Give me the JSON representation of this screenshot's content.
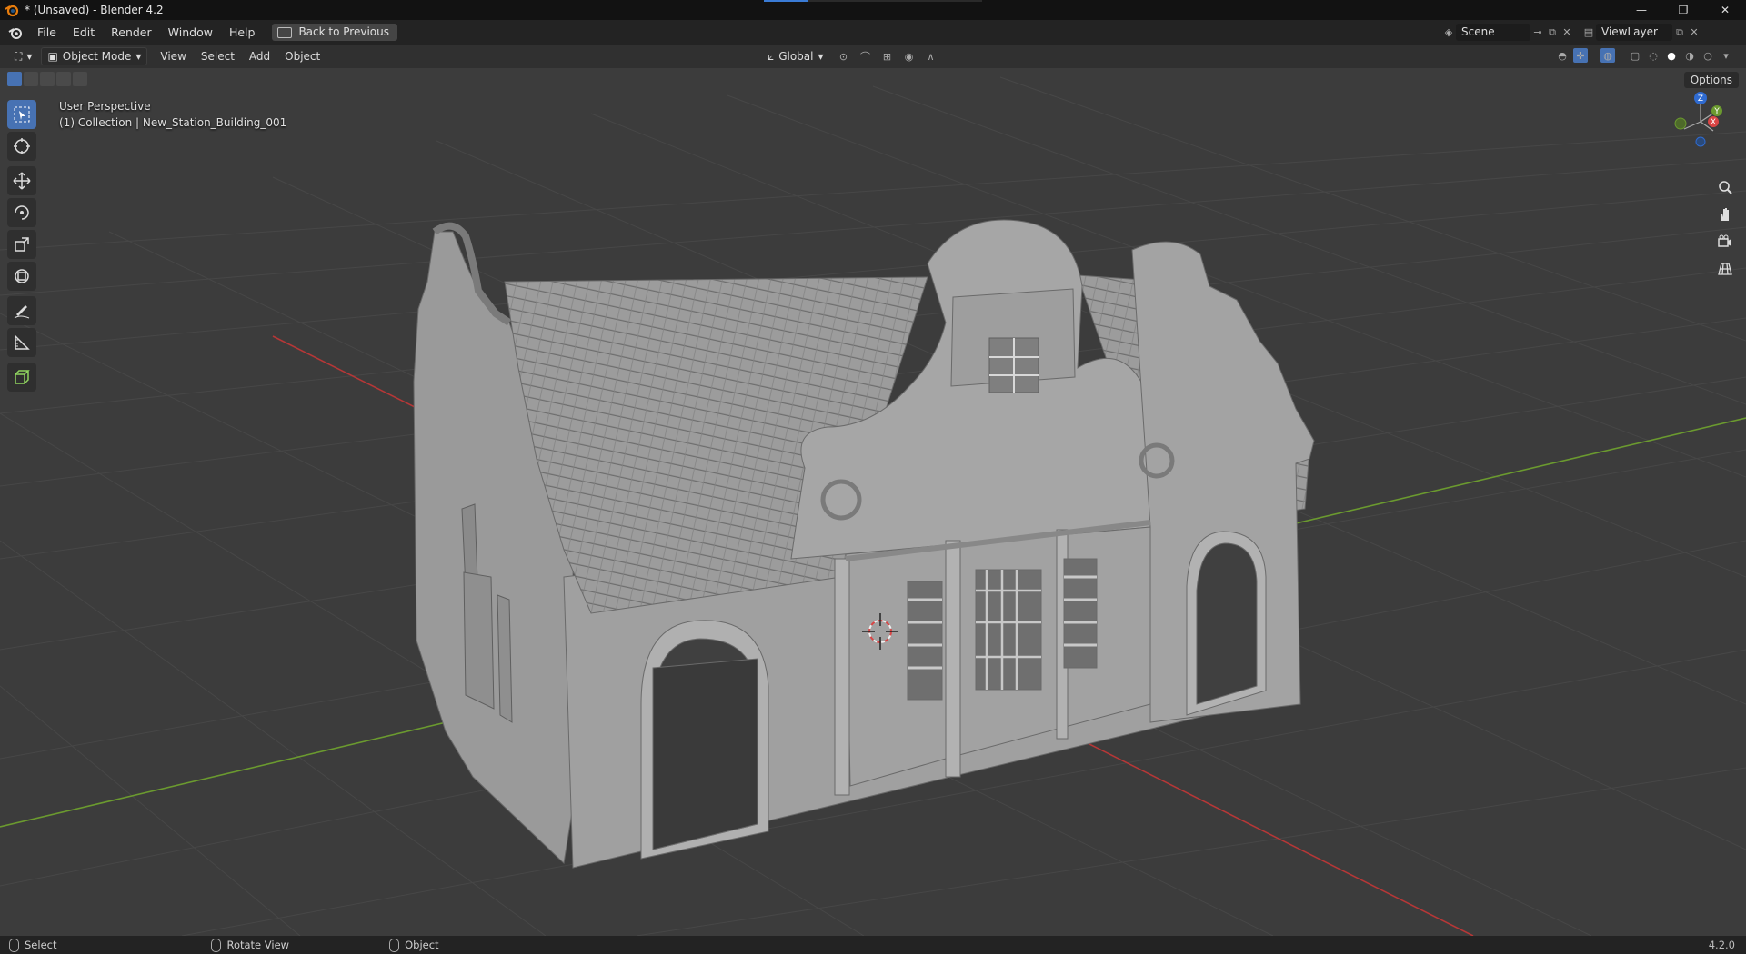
{
  "window": {
    "title": "* (Unsaved) - Blender 4.2",
    "controls": {
      "minimize": "—",
      "restore": "❐",
      "close": "✕"
    },
    "progress": 0.2
  },
  "menubar": {
    "items": [
      "File",
      "Edit",
      "Render",
      "Window",
      "Help"
    ],
    "back_button": "Back to Previous",
    "scene": "Scene",
    "view_layer": "ViewLayer"
  },
  "header": {
    "mode": "Object Mode",
    "menus": [
      "View",
      "Select",
      "Add",
      "Object"
    ],
    "transform_orientation": "Global",
    "options_label": "Options"
  },
  "viewport": {
    "perspective": "User Perspective",
    "collection_info": "(1) Collection | New_Station_Building_001",
    "gizmo_labels": {
      "z": "Z",
      "y": "Y",
      "x": "X"
    },
    "tools": [
      "select-box",
      "cursor",
      "move",
      "rotate",
      "scale",
      "transform",
      "annotate",
      "measure",
      "add-cube"
    ],
    "colors": {
      "background": "#3c3c3c",
      "grid": "#4a4a4a",
      "x_axis": "#b53737",
      "y_axis": "#6b9a2f",
      "accent": "#4772b3"
    }
  },
  "statusbar": {
    "items": [
      "Select",
      "Rotate View",
      "Object"
    ],
    "version": "4.2.0"
  }
}
